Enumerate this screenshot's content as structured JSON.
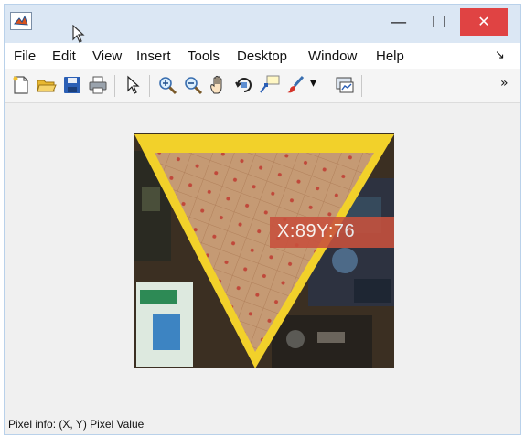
{
  "window": {
    "minimize_label": "—",
    "maximize_label": "☐",
    "close_label": "✕"
  },
  "menu": [
    "File",
    "Edit",
    "View",
    "Insert",
    "Tools",
    "Desktop",
    "Window",
    "Help"
  ],
  "menu_overflow": "↘",
  "toolbar": {
    "icons": [
      "new-figure-icon",
      "open-file-icon",
      "save-icon",
      "print-icon",
      "pointer-icon",
      "zoom-in-icon",
      "zoom-out-icon",
      "pan-hand-icon",
      "rotate-3d-icon",
      "data-cursor-icon",
      "brush-icon",
      "brush-dropdown-icon",
      "link-plot-icon"
    ],
    "overflow": "»"
  },
  "image": {
    "tooltip": "X:89Y:76"
  },
  "status": {
    "pixel_info": "Pixel info: (X, Y)  Pixel Value"
  }
}
